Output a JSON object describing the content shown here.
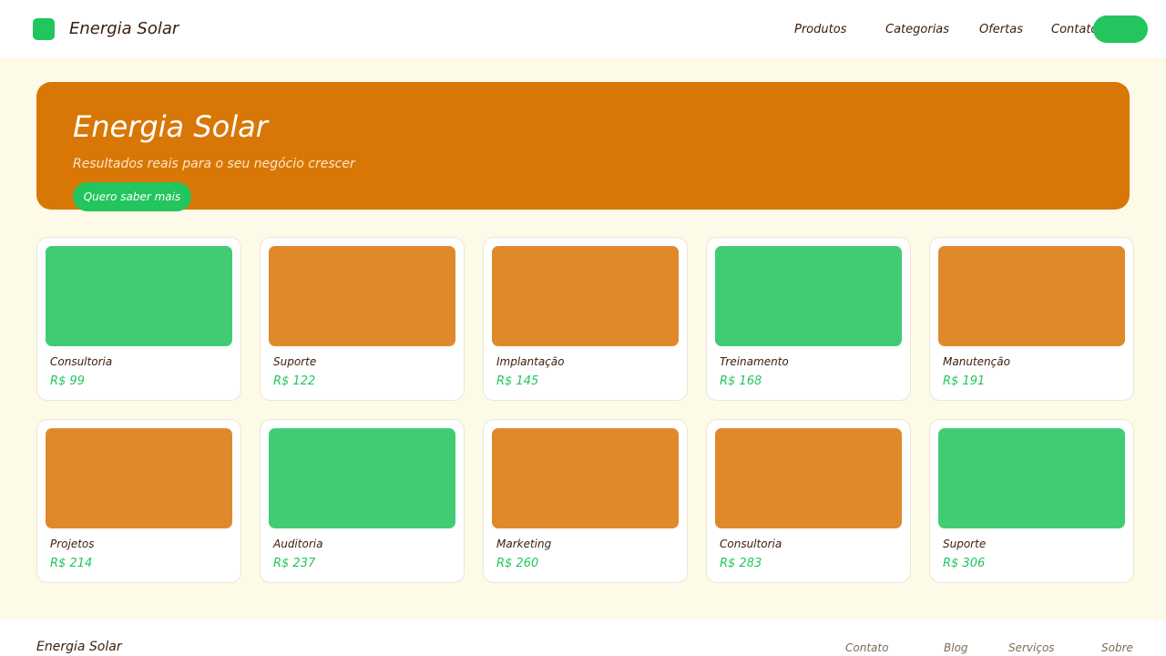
{
  "header": {
    "brand": "Energia Solar",
    "nav": [
      "Produtos",
      "Categorias",
      "Ofertas",
      "Contato"
    ],
    "cta_label": ""
  },
  "hero": {
    "title": "Energia Solar",
    "subtitle": "Resultados reais para o seu negócio crescer",
    "button": "Quero saber mais"
  },
  "products": [
    {
      "name": "Consultoria",
      "price": "R$ 99",
      "color": "#41cc74"
    },
    {
      "name": "Suporte",
      "price": "R$ 122",
      "color": "#e0892b"
    },
    {
      "name": "Implantação",
      "price": "R$ 145",
      "color": "#e0892b"
    },
    {
      "name": "Treinamento",
      "price": "R$ 168",
      "color": "#41cc74"
    },
    {
      "name": "Manutenção",
      "price": "R$ 191",
      "color": "#e0892b"
    },
    {
      "name": "Projetos",
      "price": "R$ 214",
      "color": "#e0892b"
    },
    {
      "name": "Auditoria",
      "price": "R$ 237",
      "color": "#41cc74"
    },
    {
      "name": "Marketing",
      "price": "R$ 260",
      "color": "#e0892b"
    },
    {
      "name": "Consultoria",
      "price": "R$ 283",
      "color": "#e0892b"
    },
    {
      "name": "Suporte",
      "price": "R$ 306",
      "color": "#41cc74"
    }
  ],
  "footer": {
    "brand": "Energia Solar",
    "links": [
      "Contato",
      "Blog",
      "Serviços",
      "Sobre"
    ]
  },
  "colors": {
    "accent_green": "#22c55e",
    "accent_orange": "#d97706",
    "background": "#fefae8"
  }
}
